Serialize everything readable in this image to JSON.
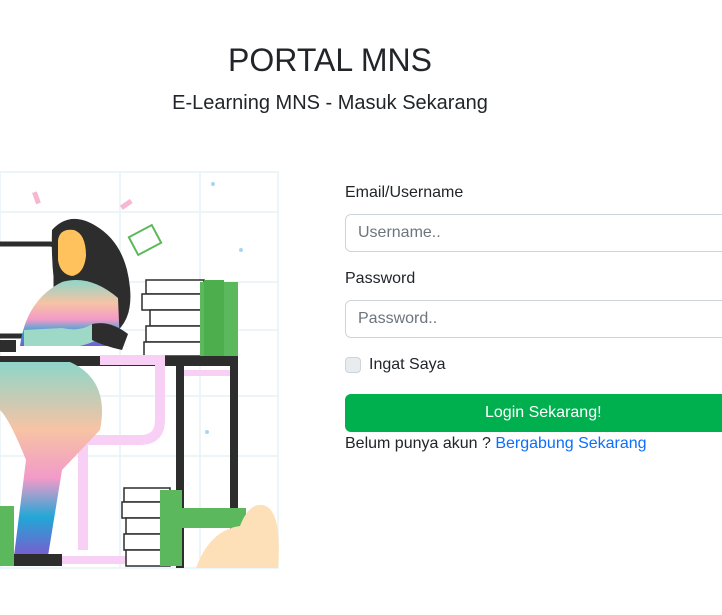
{
  "header": {
    "title": "PORTAL MNS",
    "subtitle": "E-Learning MNS - Masuk Sekarang"
  },
  "illustration": {
    "icon": "person-working-at-desk-illustration"
  },
  "form": {
    "email_label": "Email/Username",
    "email_placeholder": "Username..",
    "email_value": "",
    "password_label": "Password",
    "password_placeholder": "Password..",
    "password_value": "",
    "remember_label": "Ingat Saya",
    "remember_checked": false,
    "login_label": "Login Sekarang!",
    "register_prefix": "Belum punya akun ?",
    "register_link": "Bergabung Sekarang"
  },
  "colors": {
    "primary_button": "#00b04f",
    "link": "#0d6efd",
    "text": "#212529"
  }
}
